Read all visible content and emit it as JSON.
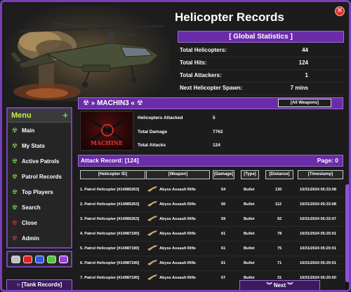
{
  "window": {
    "title": "Helicopter Records",
    "close_symbol": "✕"
  },
  "global_stats": {
    "header": "[ Global Statistics ]",
    "rows": [
      {
        "label": "Total Helicopters:",
        "value": "44"
      },
      {
        "label": "Total Hits:",
        "value": "124"
      },
      {
        "label": "Total Attackers:",
        "value": "1"
      },
      {
        "label": "Next Helicopter Spawn:",
        "value": "7 mins"
      }
    ]
  },
  "menu": {
    "title": "Menu",
    "plus": "+",
    "items": [
      {
        "label": "Main",
        "icon": "radiation-icon",
        "color": "#7ee34f"
      },
      {
        "label": "My Stats",
        "icon": "radiation-icon",
        "color": "#7ee34f"
      },
      {
        "label": "Active Patrols",
        "icon": "radiation-icon",
        "color": "#7ee34f"
      },
      {
        "label": "Patrol Records",
        "icon": "radiation-icon",
        "color": "#7ee34f"
      },
      {
        "label": "Top Players",
        "icon": "radiation-icon",
        "color": "#7ee34f"
      },
      {
        "label": "Search",
        "icon": "radiation-icon",
        "color": "#7ee34f"
      },
      {
        "label": "Close",
        "icon": "radiation-icon",
        "color": "#e03535"
      },
      {
        "label": "Admin",
        "icon": "radiation-icon",
        "color": "#e03535"
      }
    ]
  },
  "theme_swatches": [
    "#c0c0c0",
    "#e01f1f",
    "#2d5ae0",
    "#4ec73a",
    "#9d3fe0"
  ],
  "player": {
    "header": "☢ » MACHIN3 « ☢",
    "weapons_button": "[All Weapons]",
    "avatar_text": "MACHINE",
    "stats": [
      {
        "label": "Helicopters Attacked",
        "value": "5"
      },
      {
        "label": "Total Damage",
        "value": "7762"
      },
      {
        "label": "Total Attacks",
        "value": "124"
      }
    ]
  },
  "attack_record": {
    "title": "Attack Record: [124]",
    "page": "Page: 0",
    "columns": [
      "[Helicopter ID]",
      "[Weapon]",
      "[Damage]",
      "[Type]",
      "[Distance]",
      "[Timestamp]"
    ],
    "rows": [
      {
        "id": "1. Patrol Helicopter [#14985263]",
        "weapon": "Abyss Assault Rifle",
        "damage": "54",
        "type": "Bullet",
        "distance": "130",
        "time": "10/31/2024 05:33:08"
      },
      {
        "id": "2. Patrol Helicopter [#14985263]",
        "weapon": "Abyss Assault Rifle",
        "damage": "56",
        "type": "Bullet",
        "distance": "112",
        "time": "10/31/2024 05:33:08"
      },
      {
        "id": "3. Patrol Helicopter [#14985263]",
        "weapon": "Abyss Assault Rifle",
        "damage": "59",
        "type": "Bullet",
        "distance": "92",
        "time": "10/31/2024 05:33:07"
      },
      {
        "id": "4. Patrol Helicopter [#14987190]",
        "weapon": "Abyss Assault Rifle",
        "damage": "61",
        "type": "Bullet",
        "distance": "78",
        "time": "10/31/2024 05:20:01"
      },
      {
        "id": "5. Patrol Helicopter [#14987190]",
        "weapon": "Abyss Assault Rifle",
        "damage": "61",
        "type": "Bullet",
        "distance": "75",
        "time": "10/31/2024 05:20:01"
      },
      {
        "id": "6. Patrol Helicopter [#14987190]",
        "weapon": "Abyss Assault Rifle",
        "damage": "61",
        "type": "Bullet",
        "distance": "71",
        "time": "10/31/2024 05:20:01"
      },
      {
        "id": "7. Patrol Helicopter [#14987190]",
        "weapon": "Abyss Assault Rifle",
        "damage": "67",
        "type": "Bullet",
        "distance": "31",
        "time": "10/31/2024 05:20:00"
      }
    ]
  },
  "footer": {
    "tank_records": "○ [Tank Records]",
    "next": "︾ Next ︾"
  },
  "colors": {
    "accent": "#6a2ca8",
    "accent_border": "#9e6ad6"
  }
}
